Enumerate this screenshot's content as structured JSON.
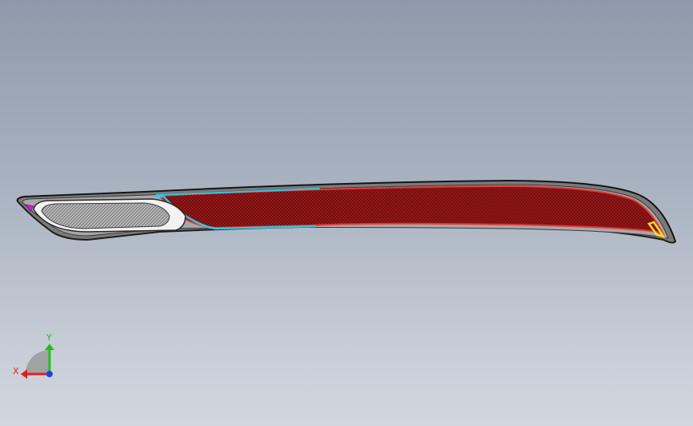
{
  "scene": {
    "background_top": "#8e9aab",
    "background_bottom": "#d2d6de",
    "part": {
      "outline_color": "#2a2a2a",
      "bezel_color": "#8c8c8c",
      "reflector_fill": "#8b1414",
      "reflector_edge": "#e03a3a",
      "cyan_edge": "#2ec8e0",
      "lamp_fill": "#d0d0d0",
      "yellow_tip": "#f0e020",
      "magenta_tip": "#d020d0"
    }
  },
  "triad": {
    "x_label": "X",
    "y_label": "Y",
    "x_color": "#e02020",
    "y_color": "#20c020",
    "z_color": "#2040e0"
  }
}
